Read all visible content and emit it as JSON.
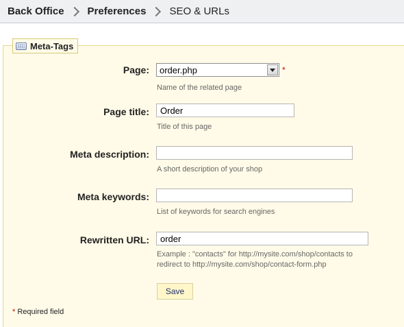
{
  "breadcrumb": {
    "items": [
      "Back Office",
      "Preferences",
      "SEO & URLs"
    ]
  },
  "fieldset": {
    "legend": "Meta-Tags",
    "icon": "keyboard-icon"
  },
  "fields": {
    "page": {
      "label": "Page:",
      "value": "order.php",
      "required_mark": "*",
      "help": "Name of the related page"
    },
    "page_title": {
      "label": "Page title:",
      "value": "Order",
      "help": "Title of this page"
    },
    "meta_description": {
      "label": "Meta description:",
      "value": "",
      "help": "A short description of your shop"
    },
    "meta_keywords": {
      "label": "Meta keywords:",
      "value": "",
      "help": "List of keywords for search engines"
    },
    "rewritten_url": {
      "label": "Rewritten URL:",
      "value": "order",
      "help_line1": "Example : \"contacts\" for http://mysite.com/shop/contacts to",
      "help_line2": "redirect to http://mysite.com/shop/contact-form.php"
    }
  },
  "actions": {
    "save_label": "Save"
  },
  "footer": {
    "required_star": "*",
    "required_text": " Required field"
  },
  "colors": {
    "fieldset_bg": "#fffbe8",
    "button_bg": "#fff7c9",
    "required": "#cc0000",
    "breadcrumb_bg": "#eef0f2"
  }
}
